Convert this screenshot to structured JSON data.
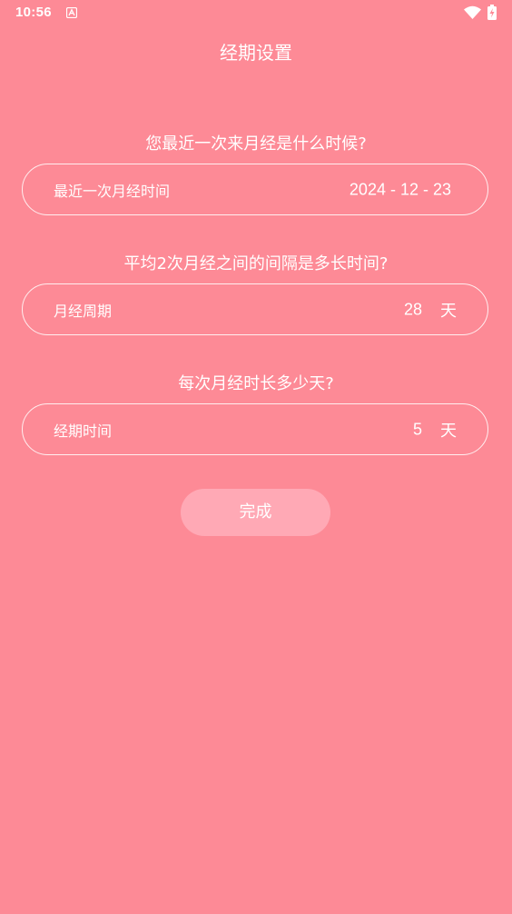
{
  "status_bar": {
    "time": "10:56",
    "notification_icon": "app-notification-icon",
    "wifi_icon": "wifi-icon",
    "battery_icon": "battery-charging-icon"
  },
  "header": {
    "title": "经期设置"
  },
  "last_period": {
    "question": "您最近一次来月经是什么时候?",
    "label": "最近一次月经时间",
    "value": "2024 - 12 - 23"
  },
  "cycle": {
    "question": "平均2次月经之间的间隔是多长时间?",
    "label": "月经周期",
    "value": "28",
    "unit": "天"
  },
  "duration": {
    "question": "每次月经时长多少天?",
    "label": "经期时间",
    "value": "5",
    "unit": "天"
  },
  "actions": {
    "done_label": "完成"
  },
  "colors": {
    "background": "#fd8a96",
    "button": "#ffa9b5",
    "text": "#ffffff"
  }
}
